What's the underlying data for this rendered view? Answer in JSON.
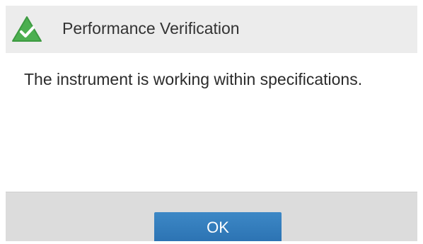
{
  "dialog": {
    "title": "Performance Verification",
    "title_icon": "success-checkmark-triangle-icon",
    "message": "The instrument is working within specifications.",
    "ok_label": "OK"
  },
  "colors": {
    "icon_green": "#4caf50",
    "button_blue": "#2f7bbd",
    "title_bar_bg": "#ececec",
    "footer_bg": "#dcdcdc"
  }
}
